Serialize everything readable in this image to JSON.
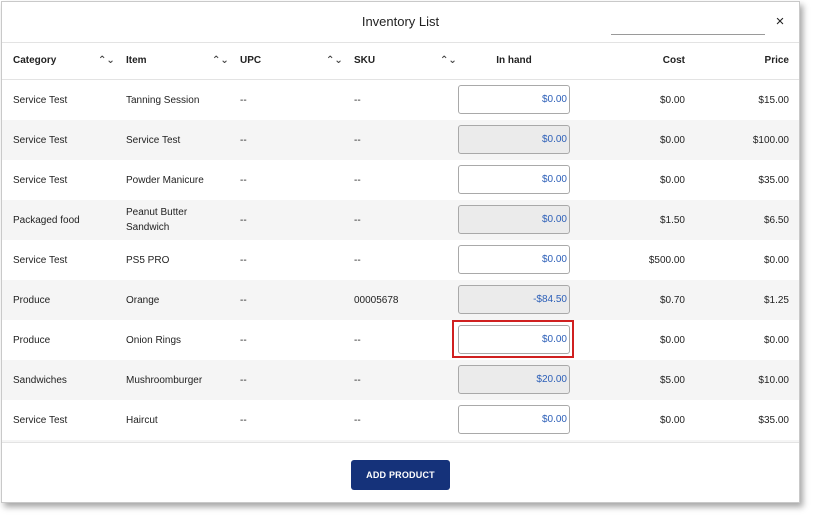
{
  "dialog": {
    "title": "Inventory List",
    "search_value": "",
    "close_glyph": "×"
  },
  "table": {
    "headers": {
      "category": "Category",
      "item": "Item",
      "upc": "UPC",
      "sku": "SKU",
      "in_hand": "In hand",
      "cost": "Cost",
      "price": "Price"
    },
    "sort_glyph": "⌃⌄",
    "rows": [
      {
        "category": "Service Test",
        "item": "Tanning Session",
        "upc": "--",
        "sku": "--",
        "in_hand": "$0.00",
        "cost": "$0.00",
        "price": "$15.00"
      },
      {
        "category": "Service Test",
        "item": "Service Test",
        "upc": "--",
        "sku": "--",
        "in_hand": "$0.00",
        "cost": "$0.00",
        "price": "$100.00"
      },
      {
        "category": "Service Test",
        "item": "Powder Manicure",
        "upc": "--",
        "sku": "--",
        "in_hand": "$0.00",
        "cost": "$0.00",
        "price": "$35.00"
      },
      {
        "category": "Packaged food",
        "item": "Peanut Butter Sandwich",
        "upc": "--",
        "sku": "--",
        "in_hand": "$0.00",
        "cost": "$1.50",
        "price": "$6.50"
      },
      {
        "category": "Service Test",
        "item": "PS5 PRO",
        "upc": "--",
        "sku": "--",
        "in_hand": "$0.00",
        "cost": "$500.00",
        "price": "$0.00"
      },
      {
        "category": "Produce",
        "item": "Orange",
        "upc": "--",
        "sku": "00005678",
        "in_hand": "-$84.50",
        "cost": "$0.70",
        "price": "$1.25"
      },
      {
        "category": "Produce",
        "item": "Onion Rings",
        "upc": "--",
        "sku": "--",
        "in_hand": "$0.00",
        "cost": "$0.00",
        "price": "$0.00"
      },
      {
        "category": "Sandwiches",
        "item": "Mushroomburger",
        "upc": "--",
        "sku": "--",
        "in_hand": "$20.00",
        "cost": "$5.00",
        "price": "$10.00"
      },
      {
        "category": "Service Test",
        "item": "Haircut",
        "upc": "--",
        "sku": "--",
        "in_hand": "$0.00",
        "cost": "$0.00",
        "price": "$35.00"
      },
      {
        "category": "",
        "item": "",
        "upc": "",
        "sku": "",
        "in_hand": "",
        "cost": "",
        "price": ""
      }
    ]
  },
  "footer": {
    "add_product_label": "ADD PRODUCT"
  },
  "colors": {
    "accent_button": "#15327a",
    "in_hand_text": "#2c5fb8",
    "highlight_border": "#d02020"
  }
}
